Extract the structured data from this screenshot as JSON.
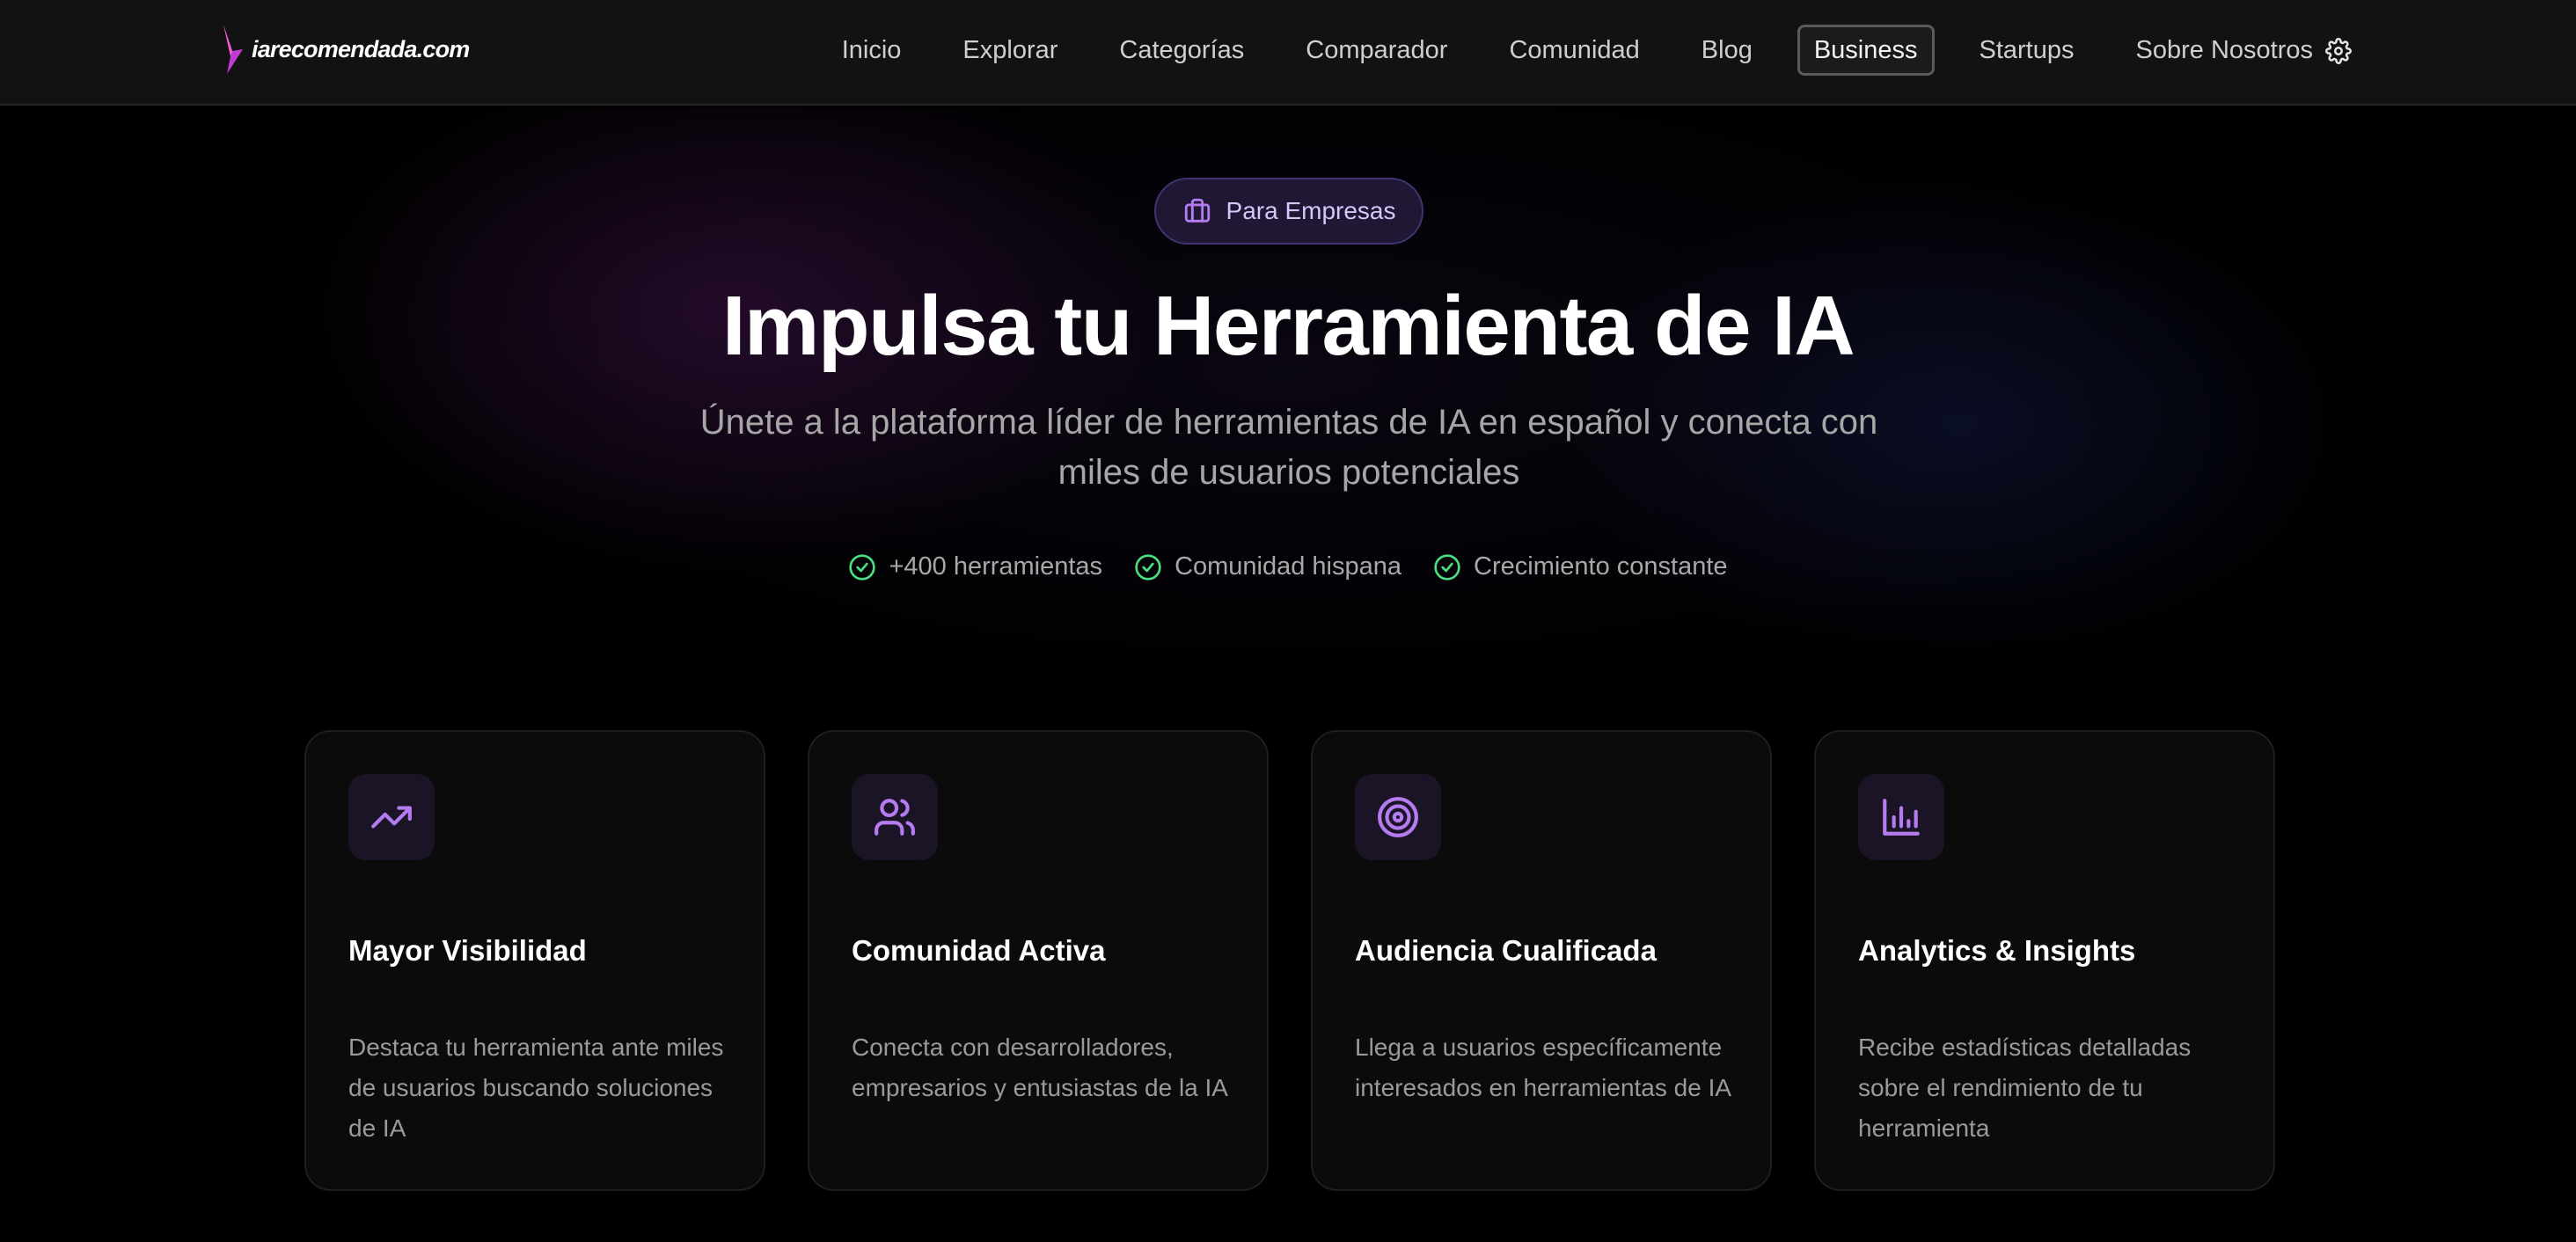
{
  "header": {
    "logo_text": "iarecomendada.com",
    "nav": [
      {
        "label": "Inicio"
      },
      {
        "label": "Explorar"
      },
      {
        "label": "Categorías"
      },
      {
        "label": "Comparador"
      },
      {
        "label": "Comunidad"
      },
      {
        "label": "Blog"
      },
      {
        "label": "Business",
        "active": true
      },
      {
        "label": "Startups"
      },
      {
        "label": "Sobre Nosotros"
      }
    ],
    "settings_icon": "gear-icon"
  },
  "hero": {
    "badge_icon": "briefcase-icon",
    "badge_label": "Para Empresas",
    "title": "Impulsa tu Herramienta de IA",
    "subtitle": "Únete a la plataforma líder de herramientas de IA en español y conecta con miles de usuarios potenciales",
    "features": [
      {
        "icon": "check-circle-icon",
        "label": "+400 herramientas"
      },
      {
        "icon": "check-circle-icon",
        "label": "Comunidad hispana"
      },
      {
        "icon": "check-circle-icon",
        "label": "Crecimiento constante"
      }
    ]
  },
  "cards": [
    {
      "icon": "trending-up-icon",
      "title": "Mayor Visibilidad",
      "description": "Destaca tu herramienta ante miles de usuarios buscando soluciones de IA"
    },
    {
      "icon": "users-icon",
      "title": "Comunidad Activa",
      "description": "Conecta con desarrolladores, empresarios y entusiastas de la IA"
    },
    {
      "icon": "target-icon",
      "title": "Audiencia Cualificada",
      "description": "Llega a usuarios específicamente interesados en herramientas de IA"
    },
    {
      "icon": "bar-chart-icon",
      "title": "Analytics & Insights",
      "description": "Recibe estadísticas detalladas sobre el rendimiento de tu herramienta"
    }
  ],
  "colors": {
    "background": "#000000",
    "navbar_bg": "#121212",
    "accent_purple": "#b57cf0",
    "check_green": "#4ade80",
    "badge_bg": "#1f1734",
    "badge_border": "#3d3470",
    "card_bg": "#0b0b0b",
    "card_icon_bg": "#1b1427"
  }
}
